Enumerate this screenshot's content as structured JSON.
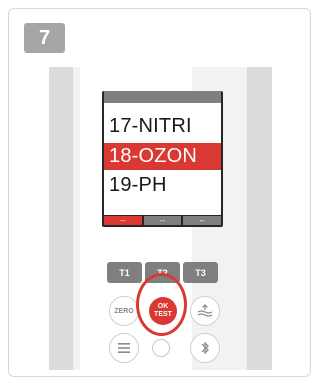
{
  "step": {
    "number": "7"
  },
  "display": {
    "menu_items": [
      "17-NITRI",
      "18-OZON",
      "19-PH"
    ],
    "selected_index": 1,
    "softkeys": [
      "--",
      "--",
      "--"
    ],
    "active_softkey": 0
  },
  "keypad": {
    "t1": "T1",
    "t2": "T2",
    "t3": "T3",
    "zero": "ZERO",
    "ok_line1": "OK",
    "ok_line2": "TEST"
  },
  "icons": {
    "fill": "water-fill-icon",
    "menu": "menu-icon",
    "bluetooth": "bluetooth-icon"
  },
  "colors": {
    "accent": "#da3832",
    "badge": "#a6a6a6",
    "key": "#7f7f7f"
  }
}
